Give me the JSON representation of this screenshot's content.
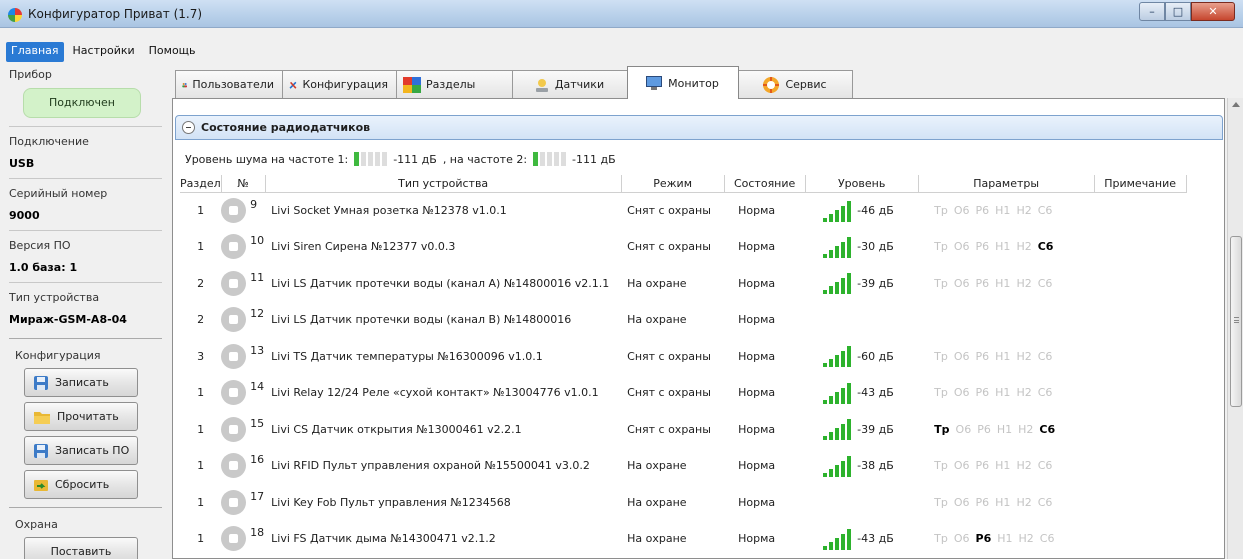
{
  "window": {
    "title": "Конфигуратор Приват (1.7)",
    "minimize": "–",
    "maximize": "□",
    "close": "✕"
  },
  "menu": {
    "items": [
      "Главная",
      "Настройки",
      "Помощь"
    ],
    "active": "Главная"
  },
  "left": {
    "device_group": "Прибор",
    "status": "Подключен",
    "connection_label": "Подключение",
    "connection_value": "USB",
    "serial_label": "Серийный номер",
    "serial_value": "9000",
    "fw_label": "Версия ПО",
    "fw_value": "1.0 база: 1",
    "type_label": "Тип устройства",
    "type_value": "Мираж-GSM-A8-04",
    "config_label": "Конфигурация",
    "write": "Записать",
    "read": "Прочитать",
    "write_fw": "Записать ПО",
    "reset": "Сбросить",
    "guard_label": "Охрана",
    "arm": "Поставить"
  },
  "tabs": [
    {
      "label": "Пользователи",
      "icon": "users-icon"
    },
    {
      "label": "Конфигурация",
      "icon": "tools-icon"
    },
    {
      "label": "Разделы",
      "icon": "sections-icon"
    },
    {
      "label": "Датчики",
      "icon": "sensors-icon"
    },
    {
      "label": "Монитор",
      "icon": "monitor-icon"
    },
    {
      "label": "Сервис",
      "icon": "service-icon"
    }
  ],
  "active_tab": "Монитор",
  "section": {
    "title": "Состояние радиодатчиков"
  },
  "noise": {
    "label1": "Уровень шума на частоте 1:",
    "value1": "-111 дБ",
    "label2": ", на частоте 2:",
    "value2": "-111 дБ",
    "level1": 1,
    "level2": 1
  },
  "table": {
    "headers": [
      "Раздел",
      "№",
      "Тип устройства",
      "Режим",
      "Состояние",
      "Уровень",
      "Параметры",
      "Примечание"
    ],
    "param_labels": [
      "Тр",
      "О6",
      "Р6",
      "Н1",
      "Н2",
      "С6"
    ],
    "rows": [
      {
        "section": "1",
        "num": "9",
        "type": "Livi Socket Умная розетка №12378 v1.0.1",
        "mode": "Снят с охраны",
        "state": "Норма",
        "level": "-46 дБ",
        "bars": 5,
        "params": [
          false,
          false,
          false,
          false,
          false,
          false
        ],
        "show_params": true,
        "icon": "socket-icon"
      },
      {
        "section": "1",
        "num": "10",
        "type": "Livi Siren Сирена №12377 v0.0.3",
        "mode": "Снят с охраны",
        "state": "Норма",
        "level": "-30 дБ",
        "bars": 5,
        "params": [
          false,
          false,
          false,
          false,
          false,
          true
        ],
        "show_params": true,
        "icon": "siren-icon"
      },
      {
        "section": "2",
        "num": "11",
        "type": "Livi LS Датчик протечки воды (канал А) №14800016 v2.1.1",
        "mode": "На охране",
        "state": "Норма",
        "level": "-39 дБ",
        "bars": 5,
        "params": [
          false,
          false,
          false,
          false,
          false,
          false
        ],
        "show_params": true,
        "icon": "water-drop-icon"
      },
      {
        "section": "2",
        "num": "12",
        "type": "Livi LS Датчик протечки воды (канал В) №14800016",
        "mode": "На охране",
        "state": "Норма",
        "level": "",
        "bars": 0,
        "params": [
          false,
          false,
          false,
          false,
          false,
          false
        ],
        "show_params": false,
        "icon": "water-drop-icon"
      },
      {
        "section": "3",
        "num": "13",
        "type": "Livi TS Датчик температуры №16300096 v1.0.1",
        "mode": "Снят с охраны",
        "state": "Норма",
        "level": "-60 дБ",
        "bars": 5,
        "params": [
          false,
          false,
          false,
          false,
          false,
          false
        ],
        "show_params": true,
        "icon": "thermometer-icon"
      },
      {
        "section": "1",
        "num": "14",
        "type": "Livi Relay 12/24 Реле «сухой контакт» №13004776 v1.0.1",
        "mode": "Снят с охраны",
        "state": "Норма",
        "level": "-43 дБ",
        "bars": 5,
        "params": [
          false,
          false,
          false,
          false,
          false,
          false
        ],
        "show_params": true,
        "icon": "relay-icon"
      },
      {
        "section": "1",
        "num": "15",
        "type": "Livi CS Датчик открытия №13000461 v2.2.1",
        "mode": "Снят с охраны",
        "state": "Норма",
        "level": "-39 дБ",
        "bars": 5,
        "params": [
          true,
          false,
          false,
          false,
          false,
          true
        ],
        "show_params": true,
        "icon": "door-sensor-icon"
      },
      {
        "section": "1",
        "num": "16",
        "type": "Livi RFID Пульт управления охраной №15500041 v3.0.2",
        "mode": "На охране",
        "state": "Норма",
        "level": "-38 дБ",
        "bars": 5,
        "params": [
          false,
          false,
          false,
          false,
          false,
          false
        ],
        "show_params": true,
        "icon": "keypad-icon"
      },
      {
        "section": "1",
        "num": "17",
        "type": "Livi Key Fob Пульт управления №1234568",
        "mode": "На охране",
        "state": "Норма",
        "level": "",
        "bars": 0,
        "params": [
          false,
          false,
          false,
          false,
          false,
          false
        ],
        "show_params": true,
        "icon": "keyfob-icon"
      },
      {
        "section": "1",
        "num": "18",
        "type": "Livi FS Датчик дыма №14300471 v2.1.2",
        "mode": "На охране",
        "state": "Норма",
        "level": "-43 дБ",
        "bars": 5,
        "params": [
          false,
          false,
          true,
          false,
          false,
          false
        ],
        "show_params": true,
        "icon": "smoke-detector-icon"
      }
    ]
  },
  "colors": {
    "signal": "#2db22d",
    "active_menu": "#2a7ad4",
    "connected_bg": "#d3f2c9"
  }
}
